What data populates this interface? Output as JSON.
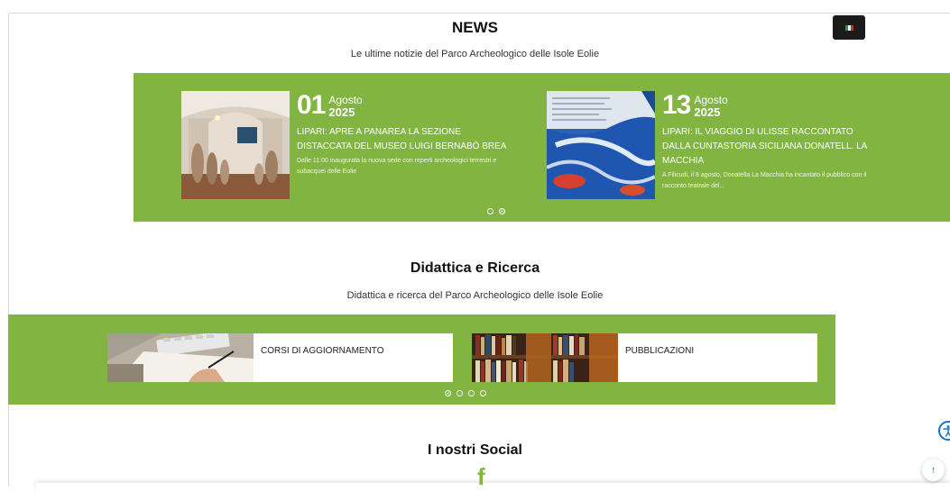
{
  "colors": {
    "green": "#82b441",
    "dark": "#1b1b1b",
    "accent_blue": "#1673c6"
  },
  "language_button": {
    "flag_icon": "italy-flag-icon"
  },
  "news": {
    "title": "NEWS",
    "subtitle": "Le ultime notizie del Parco Archeologico delle Isole Eolie",
    "items": [
      {
        "day": "01",
        "month": "Agosto",
        "year": "2025",
        "headline": "LIPARI: APRE A PANAREA LA SEZIONE DISTACCATA DEL MUSEO LUIGI BERNABÒ BREA",
        "excerpt": "Dalle 11:00 inaugurata la nuova sede con reperti archeologici terrestri e subacquei delle Eolie"
      },
      {
        "day": "13",
        "month": "Agosto",
        "year": "2025",
        "headline": "LIPARI: IL VIAGGIO DI ULISSE RACCONTATO DALLA CUNTASTORIA SICILIANA DONATELL. LA MACCHIA",
        "excerpt": "A Filicudi, il 8 agosto, Donatella La Macchia ha incantato il pubblico con il racconto teatrale del..."
      }
    ],
    "pager": {
      "total": 2,
      "active": 2
    }
  },
  "didattica": {
    "title": "Didattica e Ricerca",
    "subtitle": "Didattica e ricerca del Parco Archeologico delle Isole Eolie",
    "items": [
      {
        "label": "CORSI DI AGGIORNAMENTO"
      },
      {
        "label": "PUBBLICAZIONI"
      }
    ],
    "pager": {
      "total": 4,
      "active": 1
    }
  },
  "social": {
    "title": "I nostri Social",
    "facebook_glyph": "f",
    "facebook_icon": "facebook-icon"
  },
  "floating": {
    "accessibility_icon": "accessibility-icon",
    "scroll_top_glyph": "↑"
  }
}
